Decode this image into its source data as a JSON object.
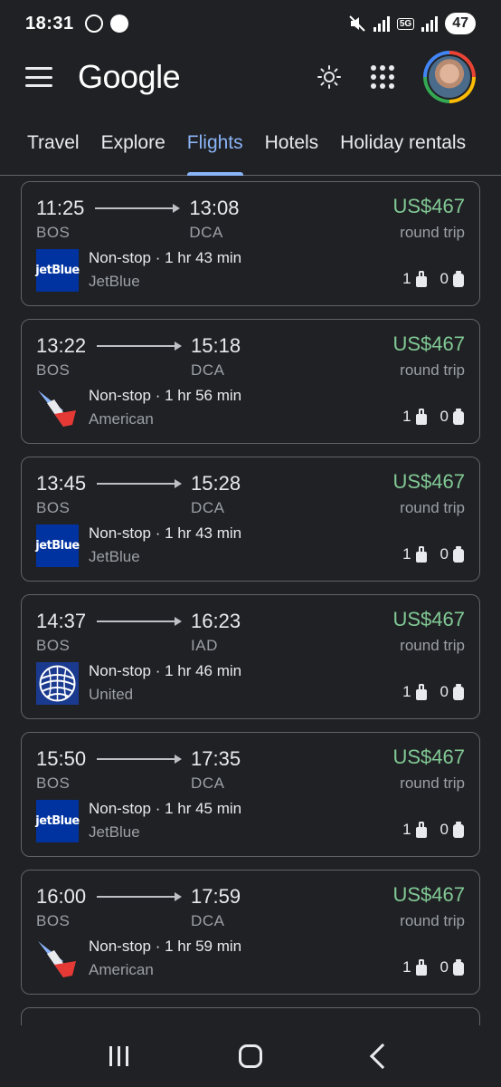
{
  "status_bar": {
    "time": "18:31",
    "network": "5G",
    "battery": "47"
  },
  "header": {
    "logo": "Google",
    "icons": [
      "menu-icon",
      "theme-sun-icon",
      "apps-grid-icon",
      "account-avatar"
    ]
  },
  "tabs": [
    {
      "label": "Travel",
      "active": false
    },
    {
      "label": "Explore",
      "active": false
    },
    {
      "label": "Flights",
      "active": true
    },
    {
      "label": "Hotels",
      "active": false
    },
    {
      "label": "Holiday rentals",
      "active": false
    }
  ],
  "flights": [
    {
      "dep": "11:25",
      "arr": "13:08",
      "from": "BOS",
      "to": "DCA",
      "price": "US$467",
      "trip": "round trip",
      "stops": "Non-stop · 1 hr 43 min",
      "airline": "JetBlue",
      "logo": "jetBlue",
      "carry_on": "1",
      "checked": "0"
    },
    {
      "dep": "13:22",
      "arr": "15:18",
      "from": "BOS",
      "to": "DCA",
      "price": "US$467",
      "trip": "round trip",
      "stops": "Non-stop · 1 hr 56 min",
      "airline": "American",
      "logo": "american",
      "carry_on": "1",
      "checked": "0"
    },
    {
      "dep": "13:45",
      "arr": "15:28",
      "from": "BOS",
      "to": "DCA",
      "price": "US$467",
      "trip": "round trip",
      "stops": "Non-stop · 1 hr 43 min",
      "airline": "JetBlue",
      "logo": "jetBlue",
      "carry_on": "1",
      "checked": "0"
    },
    {
      "dep": "14:37",
      "arr": "16:23",
      "from": "BOS",
      "to": "IAD",
      "price": "US$467",
      "trip": "round trip",
      "stops": "Non-stop · 1 hr 46 min",
      "airline": "United",
      "logo": "united",
      "carry_on": "1",
      "checked": "0"
    },
    {
      "dep": "15:50",
      "arr": "17:35",
      "from": "BOS",
      "to": "DCA",
      "price": "US$467",
      "trip": "round trip",
      "stops": "Non-stop · 1 hr 45 min",
      "airline": "JetBlue",
      "logo": "jetBlue",
      "carry_on": "1",
      "checked": "0"
    },
    {
      "dep": "16:00",
      "arr": "17:59",
      "from": "BOS",
      "to": "DCA",
      "price": "US$467",
      "trip": "round trip",
      "stops": "Non-stop · 1 hr 59 min",
      "airline": "American",
      "logo": "american",
      "carry_on": "1",
      "checked": "0"
    }
  ],
  "colors": {
    "background": "#202124",
    "accent": "#8ab4f8",
    "price": "#81c995",
    "jetblue": "#0033a0",
    "united": "#1a3a8f"
  },
  "nav_bar": {
    "icons": [
      "recent-apps-icon",
      "home-icon",
      "back-icon"
    ]
  }
}
